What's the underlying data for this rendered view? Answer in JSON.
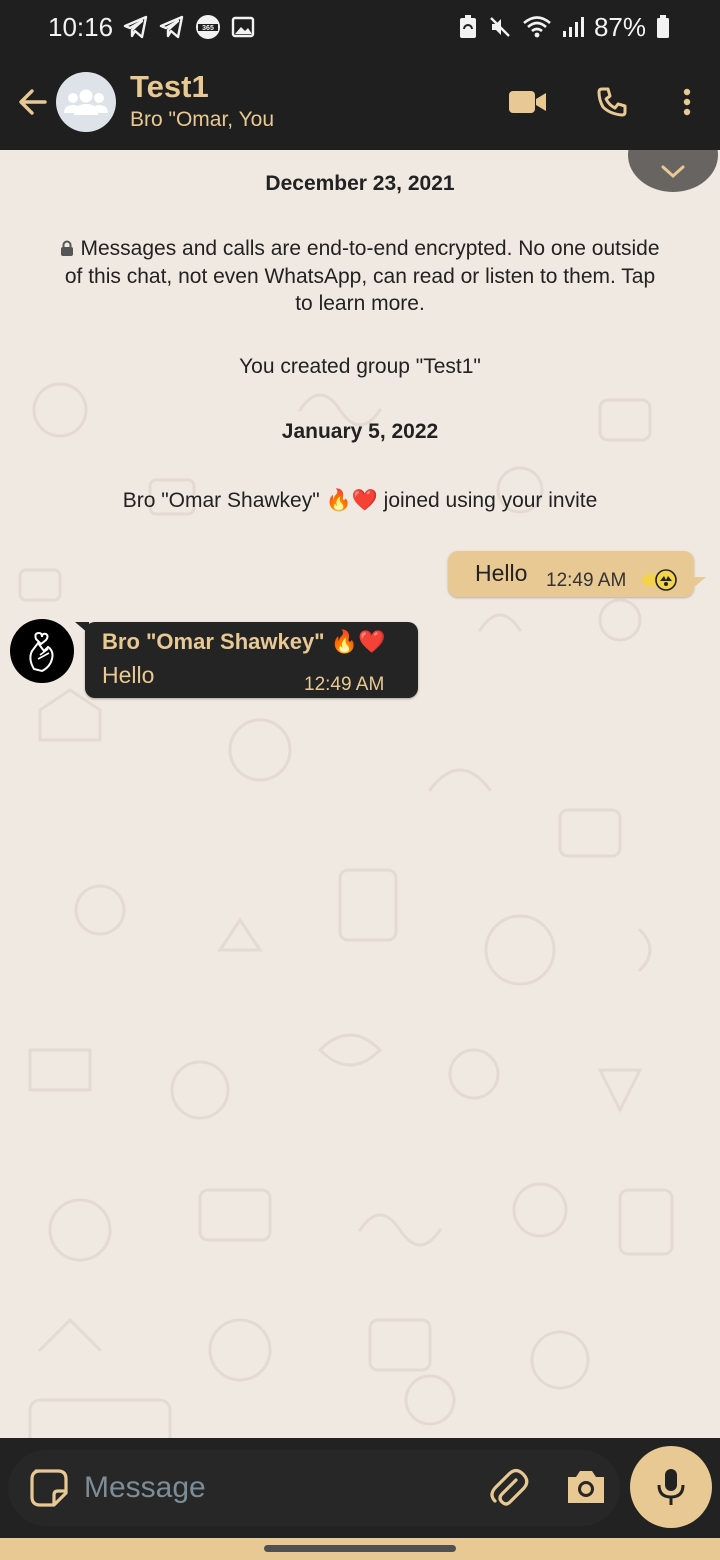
{
  "status_bar": {
    "time": "10:16",
    "battery": "87%",
    "left_icons": [
      "telegram-icon",
      "telegram-icon",
      "app-365-icon",
      "gallery-icon"
    ],
    "right_icons": [
      "battery-saver-icon",
      "mute-icon",
      "wifi-icon",
      "signal-icon",
      "battery-icon"
    ]
  },
  "header": {
    "title": "Test1",
    "subtitle": "Bro \"Omar, You",
    "icons": [
      "back-arrow-icon",
      "group-avatar-icon",
      "video-call-icon",
      "voice-call-icon",
      "more-options-icon"
    ]
  },
  "chat": {
    "date_1": "December 23, 2021",
    "encryption_notice": "Messages and calls are end-to-end encrypted. No one outside of this chat, not even WhatsApp, can read or listen to them. Tap to learn more.",
    "group_created": "You created group \"Test1\"",
    "date_2": "January 5, 2022",
    "joined_notice": {
      "prefix": "Bro \"Omar Shawkey\"",
      "emojis": "🔥❤️",
      "suffix": "joined using your invite"
    },
    "messages": [
      {
        "direction": "outgoing",
        "text": "Hello",
        "time": "12:49 AM"
      },
      {
        "direction": "incoming",
        "sender": "Bro \"Omar Shawkey\"",
        "sender_emojis": "🔥❤️",
        "text": "Hello",
        "time": "12:49 AM"
      }
    ]
  },
  "composer": {
    "placeholder": "Message",
    "icons": [
      "sticker-icon",
      "attach-icon",
      "camera-icon",
      "mic-icon"
    ]
  },
  "colors": {
    "accent": "#e9c993",
    "bar_background": "#1f1f1f",
    "chat_background": "#f0e9e1",
    "incoming_bubble": "#242424"
  }
}
